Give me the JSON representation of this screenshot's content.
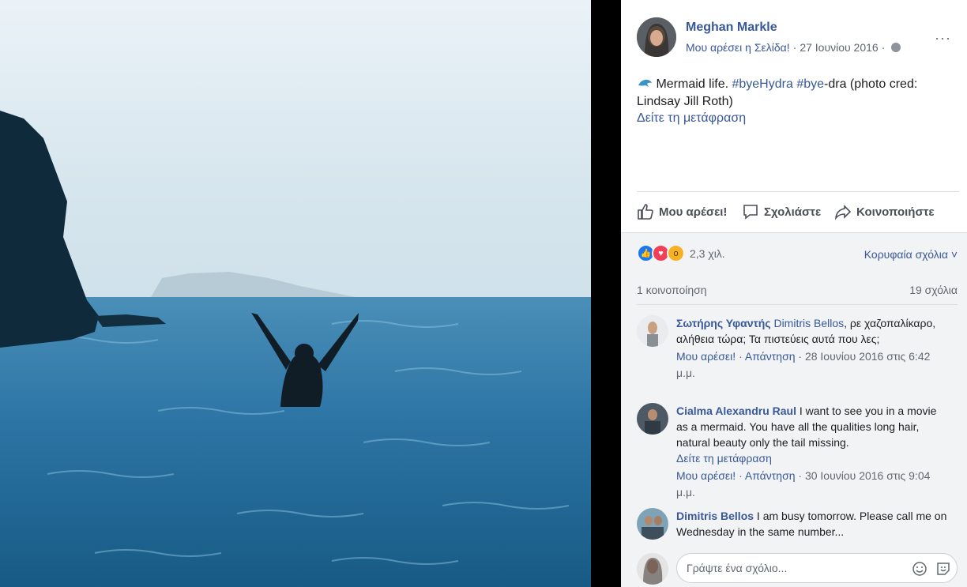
{
  "photo": {
    "alt": "Mermaid life photo"
  },
  "post": {
    "author": "Meghan Markle",
    "liked_page": "Μου αρέσει η Σελίδα!",
    "date": "27 Ιουνίου 2016",
    "menu_label": "···",
    "text_main": "Mermaid life. ",
    "hashtag1": "#byeHydra",
    "hashtag2": "#bye",
    "text_rest": "-dra (photo cred: Lindsay Jill Roth)",
    "see_translation": "Δείτε τη μετάφραση"
  },
  "actions": {
    "like": "Μου αρέσει!",
    "comment": "Σχολιάστε",
    "share": "Κοινοποιήστε"
  },
  "stats": {
    "reactions_count": "2,3 χιλ.",
    "top_comments": "Κορυφαία σχόλια ˅",
    "shares": "1 κοινοποίηση",
    "comments_count": "19 σχόλια"
  },
  "comments": [
    {
      "name": "Σωτήρης Υφαντής",
      "tag": "Dimitris Bellos",
      "text": ", ρε χαζοπαλίκαρο, αλήθεια τώρα; Τα πιστεύεις αυτά που λες;",
      "like": "Μου αρέσει!",
      "reply": "Απάντηση",
      "time": "28 Ιουνίου 2016 στις 6:42 μ.μ."
    },
    {
      "name": "Cialma Alexandru Raul",
      "text": " I want to see you in a movie as a mermaid. You have all the qualities long hair, natural beauty only the tail missing.",
      "see_translation": "Δείτε τη μετάφραση",
      "like": "Μου αρέσει!",
      "reply": "Απάντηση",
      "time": "30 Ιουνίου 2016 στις 9:04 μ.μ."
    },
    {
      "name": "Dimitris Bellos",
      "text": " I am busy tomorrow. Please call me on Wednesday in the same number..."
    }
  ],
  "composer": {
    "placeholder": "Γράψτε ένα σχόλιο..."
  },
  "colors": {
    "link": "#385898",
    "text": "#1c1e21",
    "meta": "#606770",
    "like_blue": "#1877f2",
    "love_red": "#f33e58",
    "wow_yellow": "#f7b125"
  },
  "icons": [
    "dolphin-icon",
    "globe-icon",
    "more-icon",
    "like-icon",
    "comment-icon",
    "share-icon",
    "like-reaction-icon",
    "love-reaction-icon",
    "wow-reaction-icon",
    "emoji-icon",
    "sticker-icon"
  ]
}
